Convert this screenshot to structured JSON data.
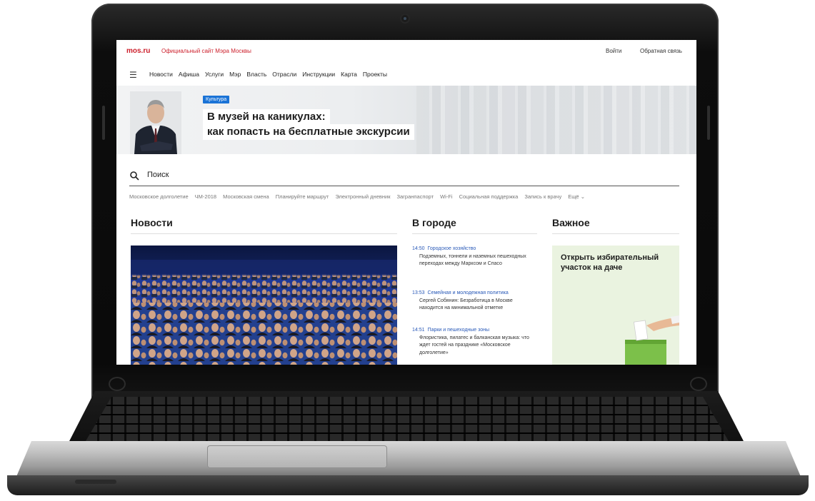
{
  "site": {
    "logo": "mos.ru",
    "title": "Официальный сайт Мэра Москвы",
    "login": "Войти",
    "feedback": "Обратная связь"
  },
  "nav": {
    "items": [
      "Новости",
      "Афиша",
      "Услуги",
      "Мэр",
      "Власть",
      "Отрасли",
      "Инструкции",
      "Карта",
      "Проекты"
    ]
  },
  "hero": {
    "tag": "Культура",
    "headline_line1": "В музей на каникулах:",
    "headline_line2": "как попасть на бесплатные экскурсии"
  },
  "search": {
    "label": "Поиск"
  },
  "quick_links": [
    "Московское долголетие",
    "ЧМ-2018",
    "Московская смена",
    "Планируйте маршрут",
    "Электронный дневник",
    "Загранпаспорт",
    "Wi-Fi",
    "Социальная поддержка",
    "Запись к врачу",
    "Ещё"
  ],
  "sections": {
    "news": "Новости",
    "city": "В городе",
    "important": "Важное"
  },
  "city_feed": [
    {
      "time": "14:50",
      "category": "Городское хозяйство",
      "text": "Подземных, тоннели и наземных пешеходных переходах между Марксом и Спасо"
    },
    {
      "time": "13:53",
      "category": "Семейная и молодежная политика",
      "text": "Сергей Собянин: Безработица в Москве находится на минимальной отметке"
    },
    {
      "time": "14:51",
      "category": "Парки и пешеходные зоны",
      "text": "Флористика, пилатес и балканская музыка: что ждет гостей на празднике «Московское долголетие»"
    }
  ],
  "promo": {
    "title": "Открыть избирательный участок на даче"
  },
  "colors": {
    "brand_red": "#cc1e2a",
    "tag_blue": "#1a73d6",
    "link_blue": "#2a5ab8",
    "promo_bg": "#eaf3e0",
    "ballot_green": "#7cc04a"
  }
}
